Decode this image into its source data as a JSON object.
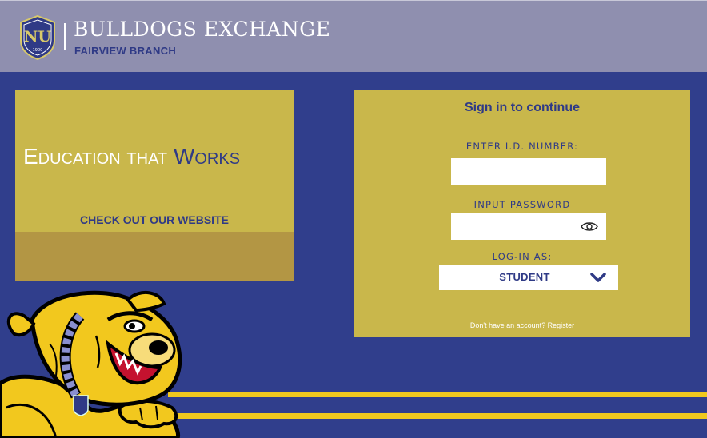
{
  "header": {
    "title": "BULLDOGS EXCHANGE",
    "subtitle": "FAIRVIEW BRANCH",
    "logo": {
      "letters": "NU",
      "year": "1900"
    }
  },
  "promo": {
    "tagline_part1": "Education that ",
    "tagline_part2": "Works",
    "website_link": "CHECK OUT OUR WEBSITE"
  },
  "login": {
    "title": "Sign in to continue",
    "id_label": "ENTER I.D. NUMBER:",
    "id_value": "",
    "password_label": "INPUT PASSWORD",
    "password_value": "",
    "role_label": "LOG-IN AS:",
    "role_value": "STUDENT",
    "register_text": "Don't have an account? Register"
  },
  "icons": {
    "logo": "school-shield-icon",
    "password_toggle": "eye-icon",
    "dropdown": "chevron-down-icon",
    "mascot": "bulldog-mascot"
  },
  "colors": {
    "navy": "#303e8c",
    "gold": "#c9b74b",
    "header_gray": "#8f8faf",
    "stripe_yellow": "#f0c81e"
  }
}
